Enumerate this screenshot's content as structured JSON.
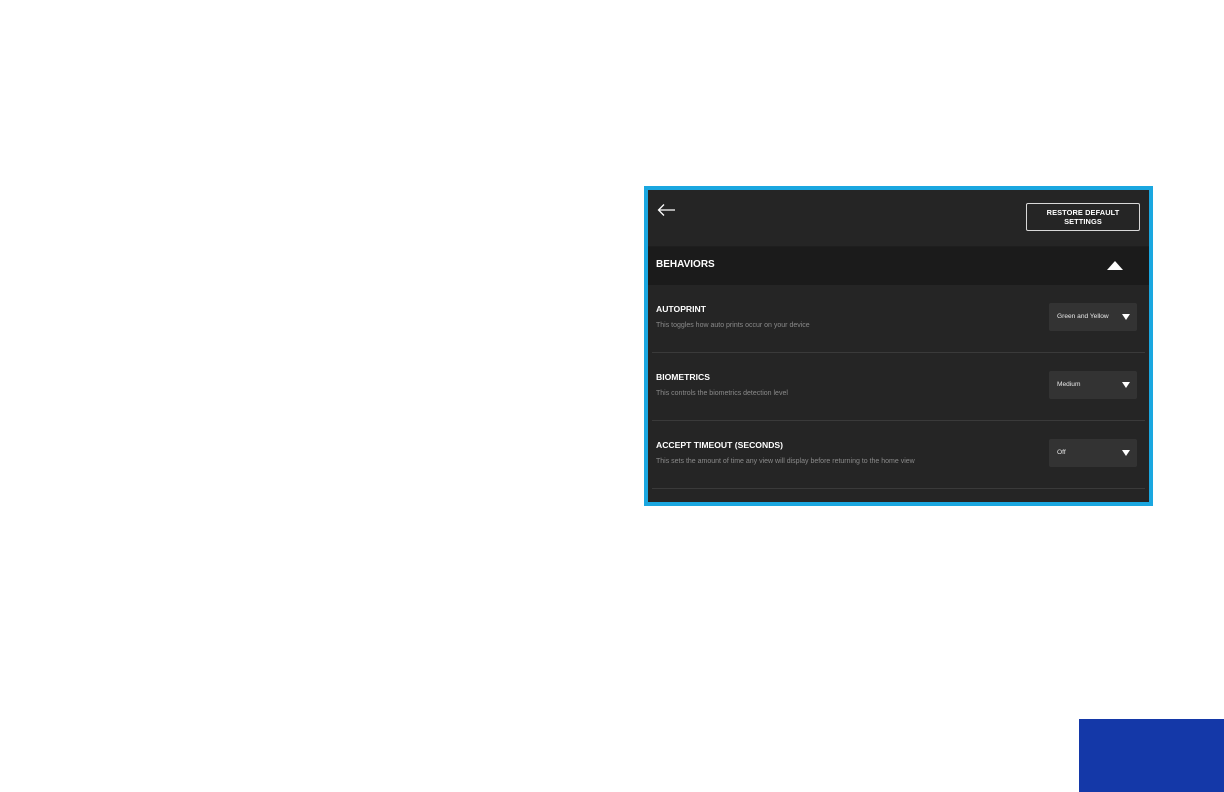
{
  "header": {
    "back_icon": "arrow-left-icon",
    "restore_label": "RESTORE DEFAULT SETTINGS"
  },
  "section": {
    "title": "BEHAVIORS",
    "toggle_icon": "caret-up-icon",
    "expanded": true
  },
  "settings": [
    {
      "title": "AUTOPRINT",
      "description": "This toggles how auto prints occur on your device",
      "value": "Green and Yellow"
    },
    {
      "title": "BIOMETRICS",
      "description": "This controls the biometrics detection level",
      "value": "Medium"
    },
    {
      "title": "ACCEPT TIMEOUT (SECONDS)",
      "description": "This sets the amount of time any view will display before returning to the home view",
      "value": "Off"
    }
  ],
  "colors": {
    "frame_border": "#1aa7e0",
    "panel_bg": "#252525",
    "section_bg": "#1b1b1b",
    "select_bg": "#333333",
    "corner_block": "#1438a8"
  }
}
